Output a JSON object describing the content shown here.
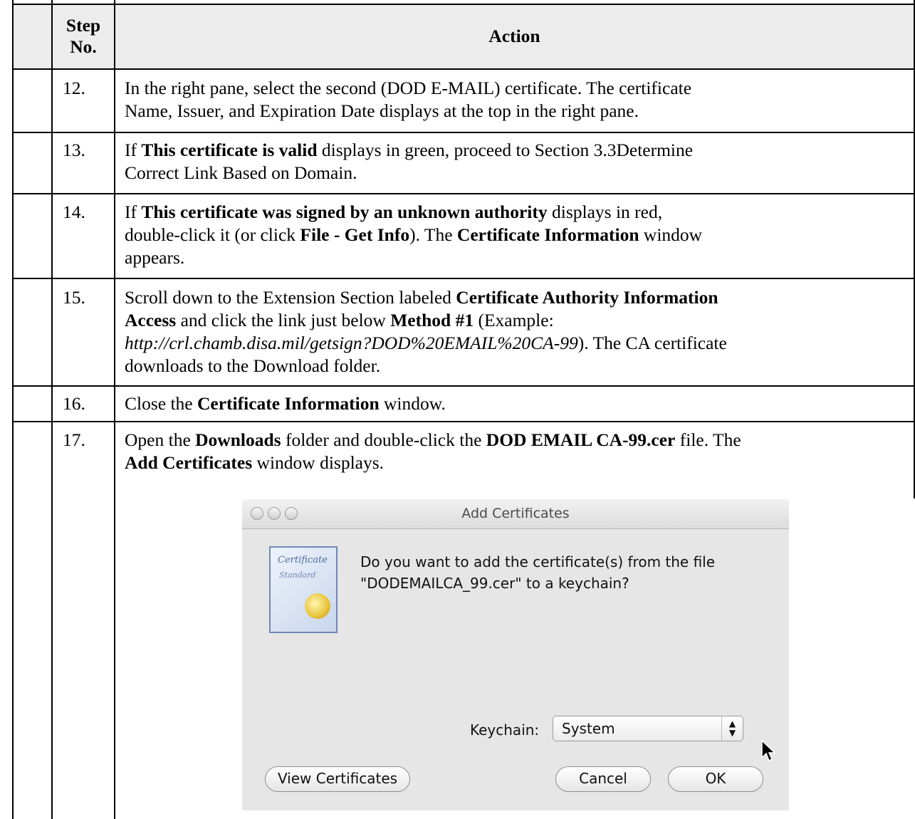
{
  "table": {
    "header": {
      "step_no": "Step No.",
      "action": "Action"
    },
    "rows": [
      {
        "step": "12.",
        "parts": [
          "In the right pane, select the second (DOD E-MAIL) certificate.  The certificate",
          "Name, Issuer, and Expiration Date displays at the top in the right pane."
        ]
      },
      {
        "step": "13.",
        "parts": [
          "If ",
          "This certificate is valid",
          " displays in green, proceed to Section 3.3Determine",
          "Correct Link Based on Domain."
        ]
      },
      {
        "step": "14.",
        "parts": [
          "If ",
          "This certificate was signed by an unknown authority",
          " displays in red,",
          "double-click it (or click ",
          "File - Get Info",
          ").  The ",
          "Certificate Information",
          " window",
          "appears."
        ]
      },
      {
        "step": "15.",
        "parts": [
          "Scroll down to the Extension Section labeled ",
          "Certificate Authority Information",
          "Access",
          " and click the link just below ",
          "Method #1",
          " (Example:",
          "http://crl.chamb.disa.mil/getsign?DOD%20EMAIL%20CA-99",
          ").  The CA certificate",
          "downloads to the Download folder."
        ]
      },
      {
        "step": "16.",
        "parts": [
          "Close the ",
          "Certificate Information",
          " window."
        ]
      },
      {
        "step": "17.",
        "parts": [
          "Open the ",
          "Downloads",
          " folder and double-click the ",
          "DOD EMAIL CA-99.cer",
          " file.  The",
          "Add Certificates",
          " window displays."
        ]
      }
    ]
  },
  "dialog": {
    "title": "Add Certificates",
    "icon_text_1": "Certificate",
    "icon_text_2": "Standard",
    "message_line1": "Do you want to add the certificate(s) from the file",
    "message_line2": "\"DODEMAILCA_99.cer\" to a keychain?",
    "keychain_label": "Keychain:",
    "keychain_value": "System",
    "view_button": "View Certificates",
    "cancel_button": "Cancel",
    "ok_button": "OK"
  }
}
